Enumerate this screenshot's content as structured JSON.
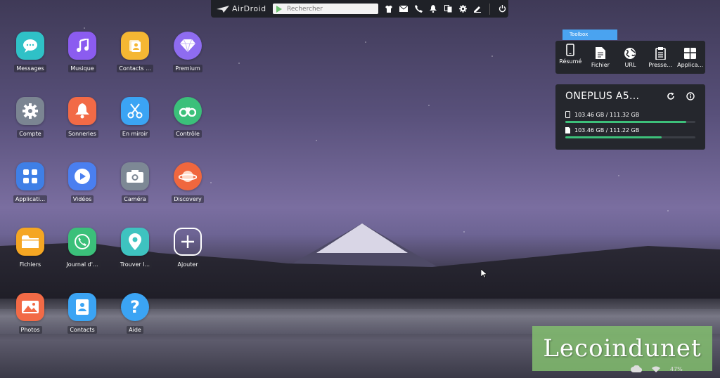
{
  "topbar": {
    "brand": "AirDroid",
    "search_placeholder": "Rechercher",
    "icons": [
      "tshirt-icon",
      "mail-icon",
      "phone-icon",
      "bell-icon",
      "screenshot-icon",
      "gear-icon",
      "edit-icon",
      "power-icon"
    ]
  },
  "desktop": {
    "apps": [
      {
        "label": "Messages",
        "color": "#2fc1c7"
      },
      {
        "label": "Musique",
        "color": "#8b5cf0"
      },
      {
        "label": "Contacts ...",
        "color": "#f5b733"
      },
      {
        "label": "Premium",
        "color": "#8e6cf0"
      },
      {
        "label": "Compte",
        "color": "#7b8592"
      },
      {
        "label": "Sonneries",
        "color": "#f26a46"
      },
      {
        "label": "En miroir",
        "color": "#3ba4f4"
      },
      {
        "label": "Contrôle",
        "color": "#3bc07a"
      },
      {
        "label": "Applicati...",
        "color": "#3f7fe6"
      },
      {
        "label": "Vidéos",
        "color": "#4a7ff0"
      },
      {
        "label": "Caméra",
        "color": "#7d8895"
      },
      {
        "label": "Discovery",
        "color": "#f0673e"
      },
      {
        "label": "Fichiers",
        "color": "#f5a623"
      },
      {
        "label": "Journal d'...",
        "color": "#3bc07a"
      },
      {
        "label": "Trouver l...",
        "color": "#3ec3c0"
      },
      {
        "label": "Ajouter",
        "color": "transparent"
      },
      {
        "label": "Photos",
        "color": "#f26a46"
      },
      {
        "label": "Contacts",
        "color": "#3ba4f4"
      },
      {
        "label": "Aide",
        "color": "#3ba4f4"
      }
    ]
  },
  "toolbox": {
    "tag": "Toolbox",
    "tools": [
      {
        "label": "Résumé",
        "icon": "phone-outline-icon"
      },
      {
        "label": "Fichier",
        "icon": "file-icon"
      },
      {
        "label": "URL",
        "icon": "globe-icon"
      },
      {
        "label": "Presse...",
        "icon": "clipboard-icon"
      },
      {
        "label": "Applica...",
        "icon": "apps-box-icon"
      }
    ]
  },
  "device": {
    "name": "ONEPLUS A5...",
    "storage": [
      {
        "text": "103.46 GB / 111.32 GB",
        "fraction": 0.93,
        "icon": "phone-small-icon"
      },
      {
        "text": "103.46 GB / 111.22 GB",
        "fraction": 0.74,
        "icon": "sdcard-icon"
      }
    ]
  },
  "watermark": {
    "text": "Lecoindunet"
  },
  "statusbar": {
    "battery": "47%"
  }
}
